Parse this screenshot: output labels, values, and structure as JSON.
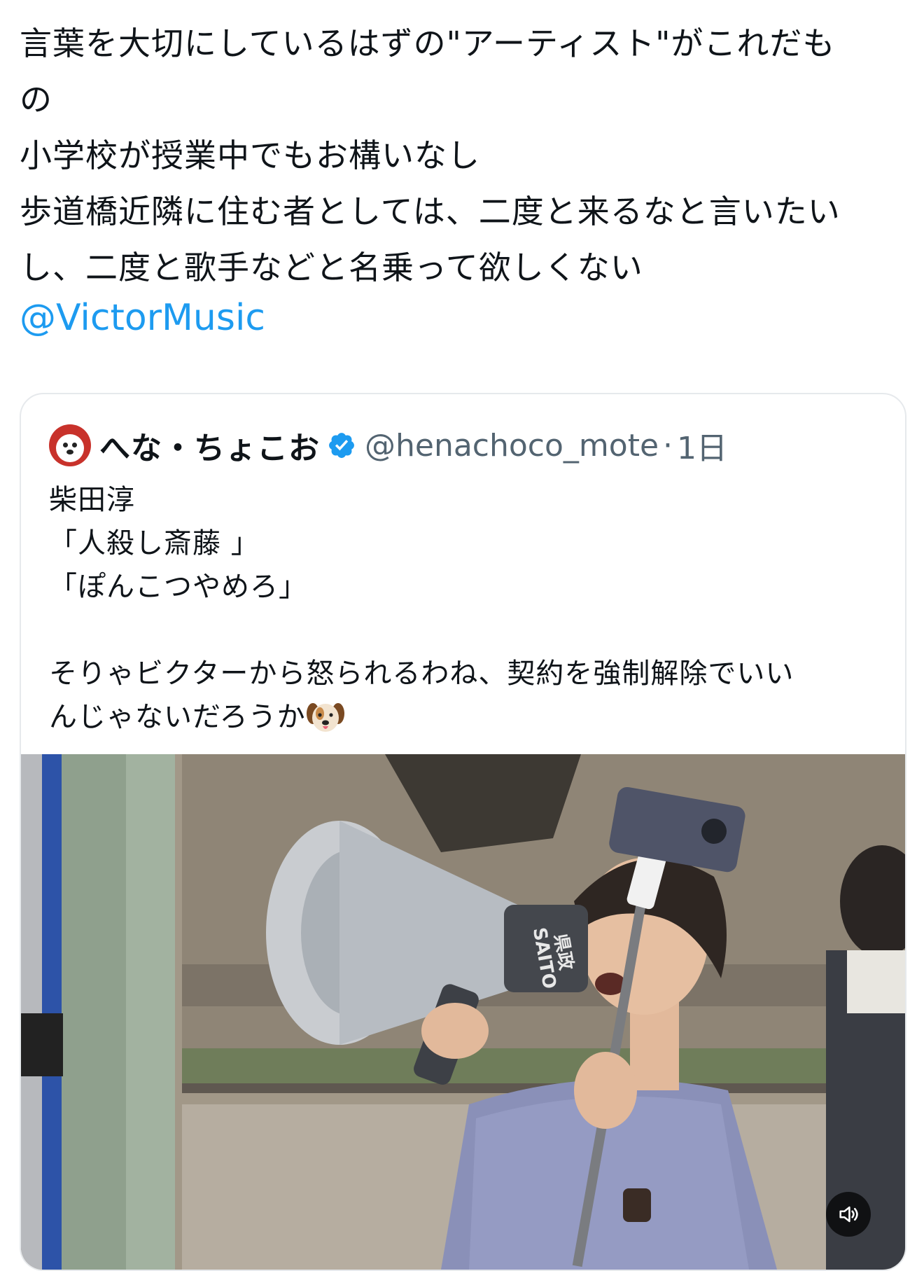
{
  "post": {
    "lines": [
      "言葉を大切にしているはずの\"アーティスト\"がこれだも",
      "の",
      "小学校が授業中でもお構いなし",
      "歩道橋近隣に住む者としては、二度と来るなと言いたい",
      "し、二度と歌手などと名乗って欲しくない"
    ],
    "mention": "@VictorMusic"
  },
  "quote": {
    "display_name": "へな・ちょこお",
    "handle": "@henachoco_mote",
    "separator": "·",
    "age": "1日",
    "verified": true,
    "lines": [
      "柴田淳",
      "「人殺し斎藤 」",
      "「ぽんこつやめろ」",
      "",
      "そりゃビクターから怒られるわね、契約を強制解除でいい",
      "んじゃないだろうか"
    ],
    "emoji": "dog-face-emoji"
  },
  "media": {
    "megaphone_text_top": "SAITO",
    "megaphone_text_bottom": "県政",
    "volume_icon": "speaker-icon"
  },
  "colors": {
    "link": "#1d9bf0",
    "secondary_text": "#536471",
    "verified_badge": "#1d9bf0",
    "card_border": "#e6e9ec"
  }
}
